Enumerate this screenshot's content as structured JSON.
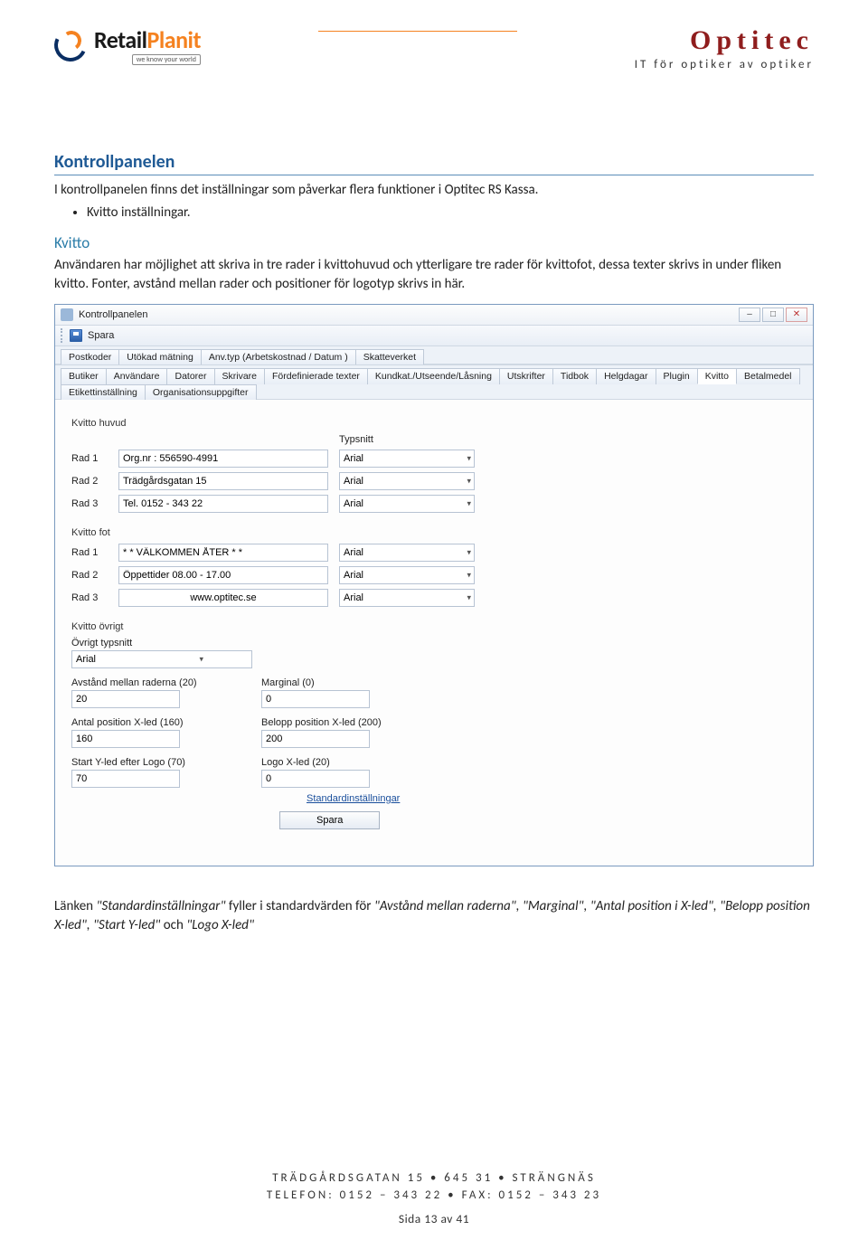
{
  "header": {
    "logo_retail": "Retail",
    "logo_planit": "Planit",
    "logo_tagline": "we know your world",
    "brand_name": "Optitec",
    "brand_sub": "IT för optiker av optiker"
  },
  "doc": {
    "h1": "Kontrollpanelen",
    "intro": "I kontrollpanelen finns det inställningar som påverkar flera funktioner i Optitec RS Kassa.",
    "bullet1": "Kvitto inställningar.",
    "h2": "Kvitto",
    "p2": "Användaren har möjlighet att skriva in tre rader i kvittohuvud och ytterligare tre rader för kvittofot, dessa texter skrivs in under fliken kvitto. Fonter, avstånd mellan rader och positioner för logotyp skrivs in här.",
    "after_plain": "Länken ",
    "after_q1": "\"Standardinställningar\"",
    "after_mid": " fyller i standardvärden för ",
    "after_q2": "\"Avstånd mellan raderna\", \"Marginal\", \"Antal position i X-led\", \"Belopp position X-led\", \"Start Y-led\"",
    "after_mid2": " och ",
    "after_q3": "\"Logo X-led\""
  },
  "app": {
    "window_title": "Kontrollpanelen",
    "save_label": "Spara",
    "tabs_top": [
      "Postkoder",
      "Utökad mätning",
      "Anv.typ (Arbetskostnad / Datum )",
      "Skatteverket"
    ],
    "tabs_bottom": [
      "Butiker",
      "Användare",
      "Datorer",
      "Skrivare",
      "Fördefinierade texter",
      "Kundkat./Utseende/Låsning",
      "Utskrifter",
      "Tidbok",
      "Helgdagar",
      "Plugin",
      "Kvitto",
      "Betalmedel",
      "Etikettinställning",
      "Organisationsuppgifter"
    ],
    "active_tab": "Kvitto",
    "typsnitt_label": "Typsnitt",
    "groups": {
      "huvud": {
        "title": "Kvitto huvud",
        "rows": [
          {
            "label": "Rad 1",
            "value": "Org.nr : 556590-4991",
            "font": "Arial"
          },
          {
            "label": "Rad 2",
            "value": "Trädgårdsgatan 15",
            "font": "Arial"
          },
          {
            "label": "Rad 3",
            "value": "Tel. 0152 - 343 22",
            "font": "Arial"
          }
        ]
      },
      "fot": {
        "title": "Kvitto fot",
        "rows": [
          {
            "label": "Rad 1",
            "value": "* * VÄLKOMMEN ÅTER * *",
            "font": "Arial"
          },
          {
            "label": "Rad 2",
            "value": "Öppettider 08.00 - 17.00",
            "font": "Arial"
          },
          {
            "label": "Rad 3",
            "value": "www.optitec.se",
            "font": "Arial"
          }
        ]
      },
      "ovrigt": {
        "title": "Kvitto övrigt",
        "ovrigt_typsnitt_label": "Övrigt typsnitt",
        "ovrigt_typsnitt_value": "Arial",
        "pairs": [
          {
            "l_label": "Avstånd mellan raderna (20)",
            "l_value": "20",
            "r_label": "Marginal (0)",
            "r_value": "0"
          },
          {
            "l_label": "Antal position X-led (160)",
            "l_value": "160",
            "r_label": "Belopp position X-led (200)",
            "r_value": "200"
          },
          {
            "l_label": "Start Y-led efter Logo (70)",
            "l_value": "70",
            "r_label": "Logo X-led (20)",
            "r_value": "0"
          }
        ]
      }
    },
    "link_standard": "Standardinställningar",
    "form_save": "Spara"
  },
  "footer": {
    "line1": "TRÄDGÅRDSGATAN 15 • 645 31 • STRÄNGNÄS",
    "line2": "TELEFON: 0152 – 343 22 • FAX: 0152 – 343 23",
    "page": "Sida 13 av 41"
  }
}
